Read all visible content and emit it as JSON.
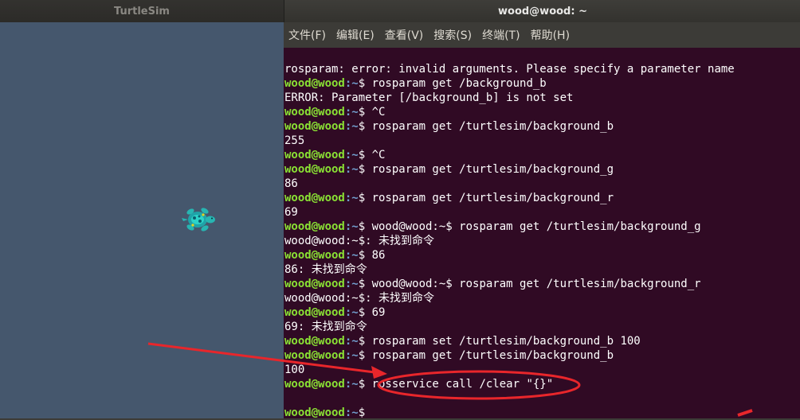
{
  "turtlesim": {
    "title": "TurtleSim"
  },
  "terminal": {
    "title": "wood@wood: ~",
    "menu": [
      {
        "label": "文件(F)"
      },
      {
        "label": "编辑(E)"
      },
      {
        "label": "查看(V)"
      },
      {
        "label": "搜索(S)"
      },
      {
        "label": "终端(T)"
      },
      {
        "label": "帮助(H)"
      }
    ],
    "prompt_user": "wood@wood",
    "prompt_path": ":~",
    "prompt_symbol": "$ ",
    "lines": [
      {
        "type": "out",
        "text": "rosparam: error: invalid arguments. Please specify a parameter name"
      },
      {
        "type": "cmd",
        "text": "rosparam get /background_b"
      },
      {
        "type": "out",
        "text": "ERROR: Parameter [/background_b] is not set"
      },
      {
        "type": "cmd",
        "text": "^C"
      },
      {
        "type": "cmd",
        "text": "rosparam get /turtlesim/background_b"
      },
      {
        "type": "out",
        "text": "255"
      },
      {
        "type": "cmd",
        "text": "^C"
      },
      {
        "type": "cmd",
        "text": "rosparam get /turtlesim/background_g"
      },
      {
        "type": "out",
        "text": "86"
      },
      {
        "type": "cmd",
        "text": "rosparam get /turtlesim/background_r"
      },
      {
        "type": "out",
        "text": "69"
      },
      {
        "type": "cmd",
        "text": "wood@wood:~$ rosparam get /turtlesim/background_g"
      },
      {
        "type": "out",
        "text": "wood@wood:~$: 未找到命令"
      },
      {
        "type": "cmd",
        "text": "86"
      },
      {
        "type": "out",
        "text": "86: 未找到命令"
      },
      {
        "type": "cmd",
        "text": "wood@wood:~$ rosparam get /turtlesim/background_r"
      },
      {
        "type": "out",
        "text": "wood@wood:~$: 未找到命令"
      },
      {
        "type": "cmd",
        "text": "69"
      },
      {
        "type": "out",
        "text": "69: 未找到命令"
      },
      {
        "type": "cmd",
        "text": "rosparam set /turtlesim/background_b 100"
      },
      {
        "type": "cmd",
        "text": "rosparam get /turtlesim/background_b"
      },
      {
        "type": "out",
        "text": "100"
      },
      {
        "type": "cmd",
        "text": "rosservice call /clear \"{}\""
      },
      {
        "type": "out",
        "text": ""
      },
      {
        "type": "cmd",
        "text": ""
      }
    ]
  },
  "colors": {
    "turtlesim_background": "#45576d",
    "terminal_background": "#300a24",
    "prompt_user": "#8ae234",
    "prompt_path": "#729fcf",
    "annotation": "#e8262b"
  }
}
